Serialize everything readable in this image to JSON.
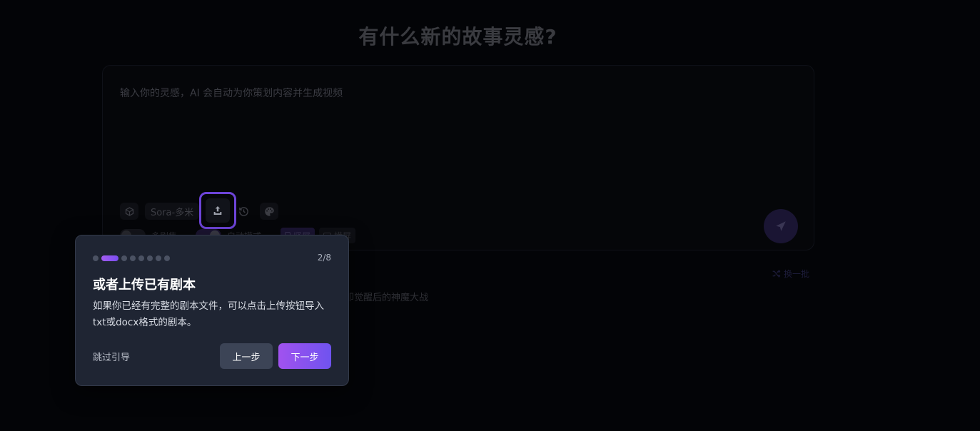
{
  "page": {
    "headline": "有什么新的故事灵感?"
  },
  "composer": {
    "placeholder": "输入你的灵感，AI 会自动为你策划内容并生成视频",
    "model": "Sora-多米",
    "toggle_multi_episode": "多剧集",
    "toggle_auto": "自动模式",
    "ratio_portrait": "竖屏",
    "ratio_landscape": "横屏"
  },
  "suggestions": {
    "refresh_label": "换一批",
    "item": "封印觉醒后的神魔大战"
  },
  "tour": {
    "step_current": 2,
    "step_total": 8,
    "counter": "2/8",
    "title": "或者上传已有剧本",
    "body": "如果你已经有完整的剧本文件，可以点击上传按钮导入txt或docx格式的剧本。",
    "skip_label": "跳过引导",
    "prev_label": "上一步",
    "next_label": "下一步"
  },
  "colors": {
    "background": "#030407",
    "accent": "#7a4ef0",
    "highlight_border": "#6d44d8",
    "popover_bg": "#1f2533"
  },
  "icons": {
    "cube": "cube-icon",
    "upload": "upload-icon",
    "history": "history-icon",
    "palette": "palette-icon",
    "send": "send-icon",
    "shuffle": "shuffle-icon"
  }
}
